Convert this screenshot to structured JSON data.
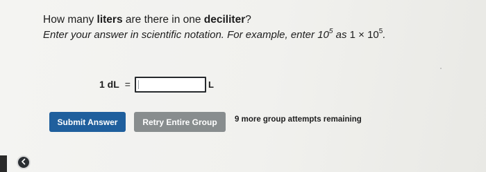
{
  "question": {
    "prefix": "How many ",
    "bold1": "liters",
    "middle": " are there in one ",
    "bold2": "deciliter",
    "suffix": "?"
  },
  "instruction": {
    "text": "Enter your answer in scientific notation. For example, enter ",
    "example_base": "10",
    "example_exp": "5",
    "as_text": " as ",
    "sci_coeff": "1",
    "times": "×",
    "sci_base": "10",
    "sci_exp": "5",
    "end": "."
  },
  "equation": {
    "lhs": "1 dL",
    "sign": "=",
    "answer_value": "",
    "unit": "L"
  },
  "buttons": {
    "submit_label": "Submit Answer",
    "retry_label": "Retry Entire Group"
  },
  "status": {
    "remaining_text": "9 more group attempts remaining"
  },
  "colors": {
    "submit_bg": "#1f5f9d",
    "retry_bg": "#888d8e",
    "page_bg": "#f2f2ef"
  },
  "icons": {
    "back": "chevron-left-icon"
  }
}
